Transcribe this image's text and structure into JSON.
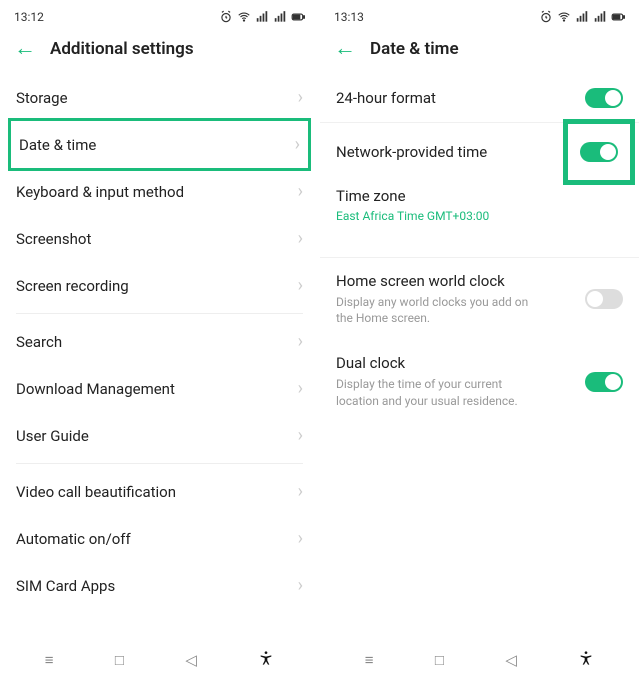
{
  "left": {
    "status_time": "13:12",
    "header_title": "Additional settings",
    "items": {
      "storage": "Storage",
      "date_time": "Date & time",
      "keyboard": "Keyboard & input method",
      "screenshot": "Screenshot",
      "screen_recording": "Screen recording",
      "search": "Search",
      "download": "Download Management",
      "user_guide": "User Guide",
      "video_call": "Video call beautification",
      "auto_onoff": "Automatic on/off",
      "sim_apps": "SIM Card Apps"
    }
  },
  "right": {
    "status_time": "13:13",
    "header_title": "Date & time",
    "format_24h": "24-hour format",
    "network_time": "Network-provided time",
    "timezone_label": "Time zone",
    "timezone_value": "East Africa Time GMT+03:00",
    "world_clock_label": "Home screen world clock",
    "world_clock_sub": "Display any world clocks you add on the Home screen.",
    "dual_clock_label": "Dual clock",
    "dual_clock_sub": "Display the time of your current location and your usual residence.",
    "toggles": {
      "format_24h": true,
      "network_time": true,
      "world_clock": false,
      "dual_clock": true
    }
  }
}
